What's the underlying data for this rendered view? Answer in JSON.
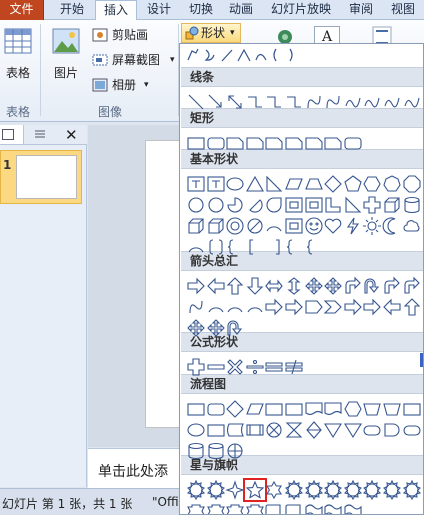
{
  "tabs": [
    "文件",
    "开始",
    "插入",
    "设计",
    "切换",
    "动画",
    "幻灯片放映",
    "审阅",
    "视图"
  ],
  "active_tab": "插入",
  "ribbon": {
    "table_label": "表格",
    "table_group": "表格",
    "picture_label": "图片",
    "clipart_label": "剪贴画",
    "screenshot_label": "屏幕截图",
    "album_label": "相册",
    "image_group": "图像",
    "shapes_label": "形状",
    "textbox_letter": "A"
  },
  "shapes_gallery": {
    "sections": [
      {
        "title": "线条"
      },
      {
        "title": "矩形"
      },
      {
        "title": "基本形状"
      },
      {
        "title": "箭头总汇"
      },
      {
        "title": "公式形状"
      },
      {
        "title": "流程图"
      },
      {
        "title": "星与旗帜"
      }
    ],
    "selected_shape": "five-point-star"
  },
  "slide_pane": {
    "slide_number": "1"
  },
  "notes": {
    "placeholder": "单击此处添"
  },
  "status_bar": {
    "slide_info": "幻灯片 第 1 张，共 1 张",
    "theme_fragment": "\"Offi"
  },
  "colors": {
    "file_tab": "#c0461f",
    "ribbon_bg": "#f4f7fb",
    "gallery_header": "#dde4ee",
    "shape_outline": "#36558f",
    "selected_highlight": "#e02222",
    "slide_selection": "#fbd983"
  }
}
